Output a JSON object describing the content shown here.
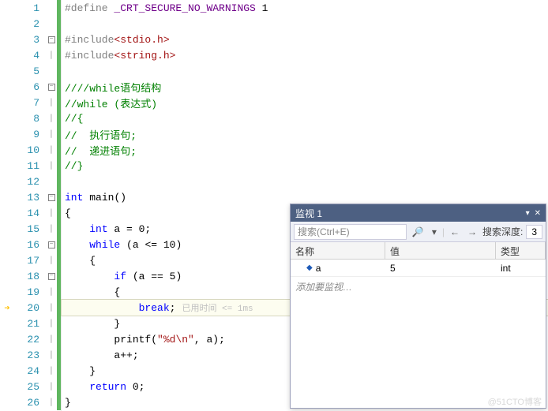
{
  "lines": [
    {
      "n": "1",
      "fold": "",
      "code": [
        {
          "c": "pp",
          "t": "#define "
        },
        {
          "c": "macro",
          "t": "_CRT_SECURE_NO_WARNINGS"
        },
        {
          "c": "txt",
          "t": " 1"
        }
      ],
      "indent": 0
    },
    {
      "n": "2",
      "fold": "",
      "code": [],
      "indent": 0
    },
    {
      "n": "3",
      "fold": "minus",
      "code": [
        {
          "c": "pp",
          "t": "#include"
        },
        {
          "c": "inc",
          "t": "<stdio.h>"
        }
      ],
      "indent": 0
    },
    {
      "n": "4",
      "fold": "bar",
      "code": [
        {
          "c": "pp",
          "t": "#include"
        },
        {
          "c": "inc",
          "t": "<string.h>"
        }
      ],
      "indent": 0
    },
    {
      "n": "5",
      "fold": "",
      "code": [],
      "indent": 0
    },
    {
      "n": "6",
      "fold": "minus",
      "code": [
        {
          "c": "cmt",
          "t": "////while语句结构"
        }
      ],
      "indent": 0
    },
    {
      "n": "7",
      "fold": "bar",
      "code": [
        {
          "c": "cmt",
          "t": "//while (表达式)"
        }
      ],
      "indent": 0
    },
    {
      "n": "8",
      "fold": "bar",
      "code": [
        {
          "c": "cmt",
          "t": "//{"
        }
      ],
      "indent": 0
    },
    {
      "n": "9",
      "fold": "bar",
      "code": [
        {
          "c": "cmt",
          "t": "//  执行语句;"
        }
      ],
      "indent": 0
    },
    {
      "n": "10",
      "fold": "bar",
      "code": [
        {
          "c": "cmt",
          "t": "//  递进语句;"
        }
      ],
      "indent": 0
    },
    {
      "n": "11",
      "fold": "bar",
      "code": [
        {
          "c": "cmt",
          "t": "//}"
        }
      ],
      "indent": 0
    },
    {
      "n": "12",
      "fold": "",
      "code": [],
      "indent": 0
    },
    {
      "n": "13",
      "fold": "minus",
      "code": [
        {
          "c": "kw",
          "t": "int"
        },
        {
          "c": "txt",
          "t": " "
        },
        {
          "c": "func",
          "t": "main"
        },
        {
          "c": "txt",
          "t": "()"
        }
      ],
      "indent": 0
    },
    {
      "n": "14",
      "fold": "bar",
      "code": [
        {
          "c": "txt",
          "t": "{"
        }
      ],
      "indent": 0
    },
    {
      "n": "15",
      "fold": "bar",
      "code": [
        {
          "c": "kw",
          "t": "int"
        },
        {
          "c": "txt",
          "t": " a = 0;"
        }
      ],
      "indent": 1
    },
    {
      "n": "16",
      "fold": "minus",
      "code": [
        {
          "c": "kw",
          "t": "while"
        },
        {
          "c": "txt",
          "t": " (a <= 10)"
        }
      ],
      "indent": 1
    },
    {
      "n": "17",
      "fold": "bar",
      "code": [
        {
          "c": "txt",
          "t": "{"
        }
      ],
      "indent": 1
    },
    {
      "n": "18",
      "fold": "minus",
      "code": [
        {
          "c": "kw",
          "t": "if"
        },
        {
          "c": "txt",
          "t": " (a == 5)"
        }
      ],
      "indent": 2
    },
    {
      "n": "19",
      "fold": "bar",
      "code": [
        {
          "c": "txt",
          "t": "{"
        }
      ],
      "indent": 2
    },
    {
      "n": "20",
      "fold": "bar",
      "code": [
        {
          "c": "kw",
          "t": "break"
        },
        {
          "c": "txt",
          "t": ";"
        }
      ],
      "indent": 3,
      "hl": true,
      "perf": "已用时间 <= 1ms",
      "ind": "arrow"
    },
    {
      "n": "21",
      "fold": "bar",
      "code": [
        {
          "c": "txt",
          "t": "}"
        }
      ],
      "indent": 2
    },
    {
      "n": "22",
      "fold": "bar",
      "code": [
        {
          "c": "func",
          "t": "printf"
        },
        {
          "c": "txt",
          "t": "("
        },
        {
          "c": "str",
          "t": "\"%d\\n\""
        },
        {
          "c": "txt",
          "t": ", a);"
        }
      ],
      "indent": 2
    },
    {
      "n": "23",
      "fold": "bar",
      "code": [
        {
          "c": "txt",
          "t": "a++;"
        }
      ],
      "indent": 2
    },
    {
      "n": "24",
      "fold": "bar",
      "code": [
        {
          "c": "txt",
          "t": "}"
        }
      ],
      "indent": 1
    },
    {
      "n": "25",
      "fold": "bar",
      "code": [
        {
          "c": "kw",
          "t": "return"
        },
        {
          "c": "txt",
          "t": " 0;"
        }
      ],
      "indent": 1
    },
    {
      "n": "26",
      "fold": "bar",
      "code": [
        {
          "c": "txt",
          "t": "}"
        }
      ],
      "indent": 0
    }
  ],
  "watch": {
    "title": "监视 1",
    "search_placeholder": "搜索(Ctrl+E)",
    "depth_label": "搜索深度:",
    "depth_value": "3",
    "columns": {
      "name": "名称",
      "value": "值",
      "type": "类型"
    },
    "rows": [
      {
        "name": "a",
        "value": "5",
        "type": "int"
      }
    ],
    "add_prompt": "添加要监视…"
  },
  "watermark": "@51CTO博客"
}
